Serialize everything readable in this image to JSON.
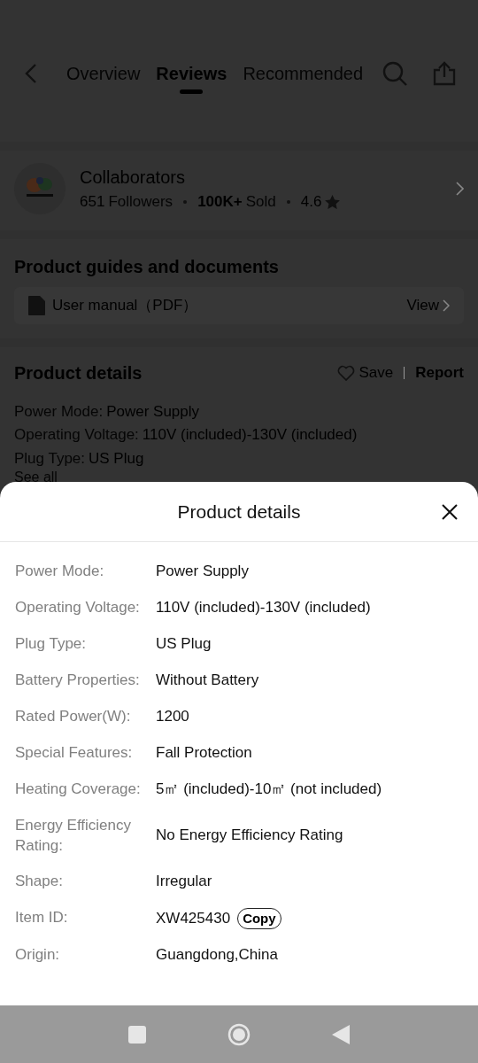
{
  "header": {
    "tabs": [
      {
        "label": "Overview",
        "selected": false
      },
      {
        "label": "Reviews",
        "selected": true
      },
      {
        "label": "Recommended",
        "selected": false
      }
    ]
  },
  "store": {
    "name": "Collaborators",
    "followers_count": "651",
    "followers_label": "Followers",
    "sold_count": "100K+",
    "sold_label": "Sold",
    "rating": "4.6"
  },
  "guides": {
    "title": "Product guides and documents",
    "document": {
      "name": "User manual（PDF）",
      "action": "View"
    }
  },
  "details": {
    "title": "Product details",
    "save": "Save",
    "report": "Report",
    "attributes": [
      {
        "label": "Power Mode:",
        "value": "Power Supply"
      },
      {
        "label": "Operating Voltage:",
        "value": "110V (included)-130V (included)"
      },
      {
        "label": "Plug Type:",
        "value": "US Plug"
      }
    ],
    "see_all": "See all"
  },
  "sheet": {
    "title": "Product details",
    "attributes": [
      {
        "label": "Power Mode:",
        "value": "Power Supply"
      },
      {
        "label": "Operating Voltage:",
        "value": "110V (included)-130V (included)"
      },
      {
        "label": "Plug Type:",
        "value": "US Plug"
      },
      {
        "label": "Battery Properties:",
        "value": "Without Battery"
      },
      {
        "label": "Rated Power(W):",
        "value": "1200"
      },
      {
        "label": "Special Features:",
        "value": "Fall Protection"
      },
      {
        "label": "Heating Coverage:",
        "value": "5㎡ (included)-10㎡ (not included)"
      },
      {
        "label": "Energy Efficiency Rating:",
        "value": "No Energy Efficiency Rating"
      },
      {
        "label": "Shape:",
        "value": "Irregular"
      },
      {
        "label": "Item ID:",
        "value": "XW425430",
        "action": "Copy"
      },
      {
        "label": "Origin:",
        "value": "Guangdong,China"
      }
    ]
  }
}
